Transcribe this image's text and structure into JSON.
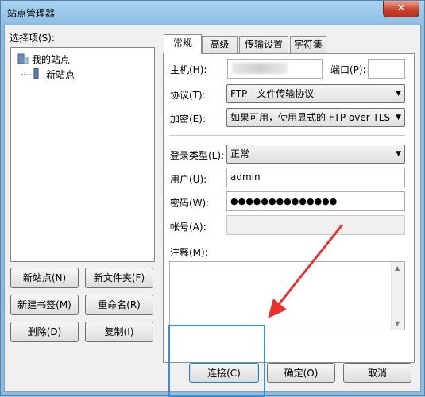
{
  "window": {
    "title": "站点管理器",
    "close_symbol": "✕"
  },
  "left": {
    "select_label": "选择项(S):",
    "tree": [
      {
        "label": "我的站点"
      },
      {
        "label": "新站点"
      }
    ],
    "buttons": {
      "new_site": "新站点(N)",
      "new_folder": "新文件夹(F)",
      "new_bookmark": "新建书签(M)",
      "rename": "重命名(R)",
      "delete": "删除(D)",
      "copy": "复制(I)"
    }
  },
  "tabs": [
    {
      "label": "常规",
      "active": true
    },
    {
      "label": "高级",
      "active": false
    },
    {
      "label": "传输设置",
      "active": false
    },
    {
      "label": "字符集",
      "active": false
    }
  ],
  "general": {
    "host_label": "主机(H):",
    "host_value": "",
    "port_label": "端口(P):",
    "port_value": "",
    "protocol_label": "协议(T):",
    "protocol_value": "FTP - 文件传输协议",
    "encryption_label": "加密(E):",
    "encryption_value": "如果可用，使用显式的 FTP over TLS",
    "logon_label": "登录类型(L):",
    "logon_value": "正常",
    "user_label": "用户(U):",
    "user_value": "admin",
    "password_label": "密码(W):",
    "password_value": "●●●●●●●●●●●●●●",
    "account_label": "帐号(A):",
    "account_value": "",
    "notes_label": "注释(M):"
  },
  "bottom": {
    "connect": "连接(C)",
    "ok": "确定(O)",
    "cancel": "取消"
  },
  "colors": {
    "annotation_box": "#3b8ed8",
    "annotation_arrow": "#e8322e"
  }
}
